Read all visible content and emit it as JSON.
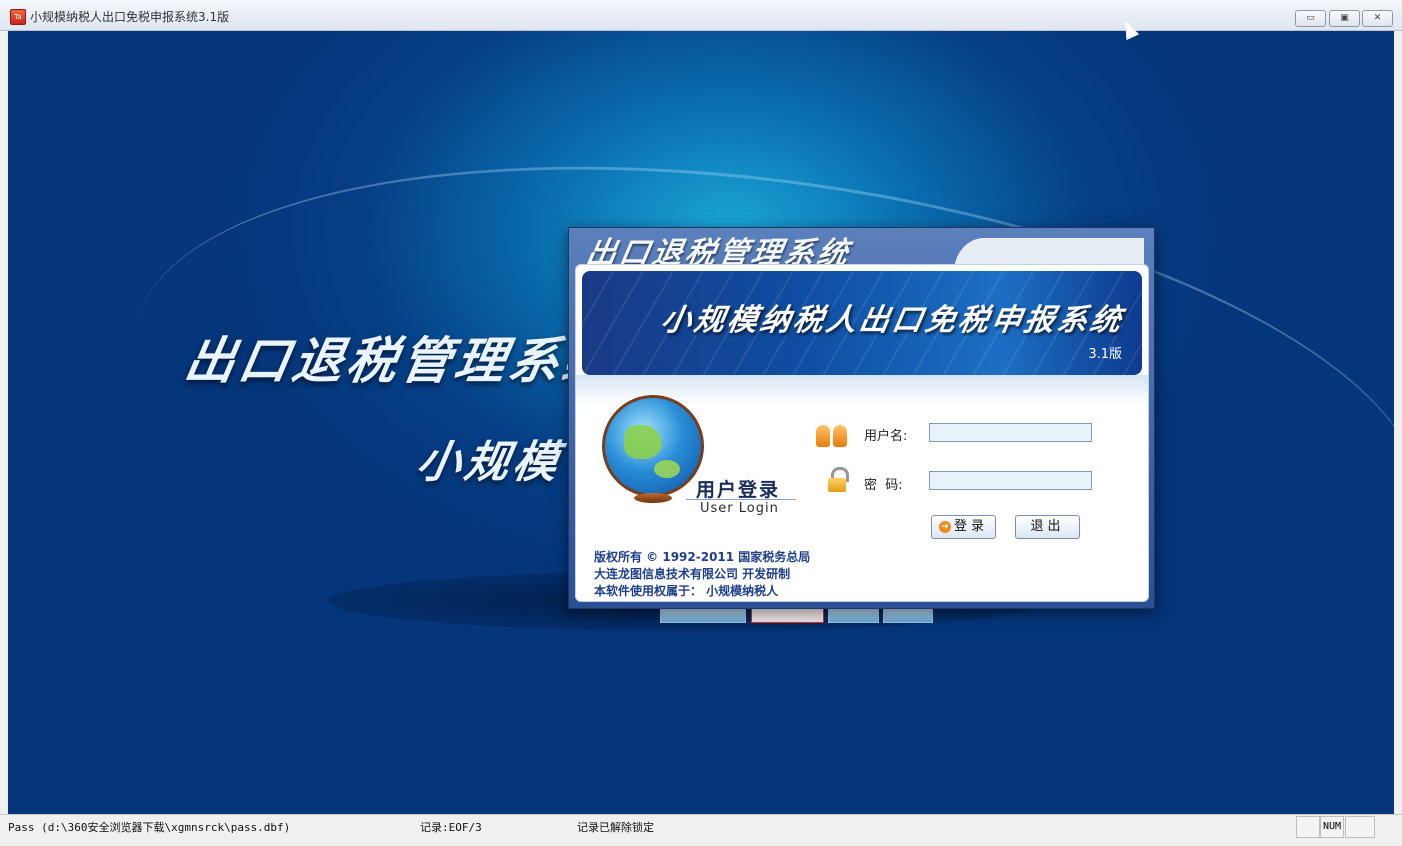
{
  "window": {
    "title": "小规模纳税人出口免税申报系统3.1版",
    "app_icon_text": "Ta",
    "minimize_glyph": "▭",
    "maximize_glyph": "▣",
    "close_glyph": "✕"
  },
  "background": {
    "title_line1": "出口退税管理系统",
    "title_line2": "小规模"
  },
  "dialog": {
    "title": "出口退税管理系统",
    "banner_title": "小规模纳税人出口免税申报系统",
    "banner_version": "3.1版",
    "login_title_cn": "用户登录",
    "login_title_en": "User Login",
    "username_label": "用户名:",
    "password_label": "密  码:",
    "username_value": "",
    "password_value": "",
    "login_button": "登录",
    "exit_button": "退出",
    "copyright_line1": "版权所有 © 1992-2011 国家税务总局",
    "copyright_line2": "大连龙图信息技术有限公司  开发研制",
    "copyright_line3": "本软件使用权属于： 小规模纳税人"
  },
  "statusbar": {
    "path": "Pass (d:\\360安全浏览器下载\\xgmnsrck\\pass.dbf)",
    "record": "记录:EOF/3",
    "lock_status": "记录已解除锁定",
    "num": "NUM"
  },
  "colors": {
    "accent": "#1f3f88",
    "background_dark": "#05357a",
    "background_light": "#1aa6d6"
  }
}
